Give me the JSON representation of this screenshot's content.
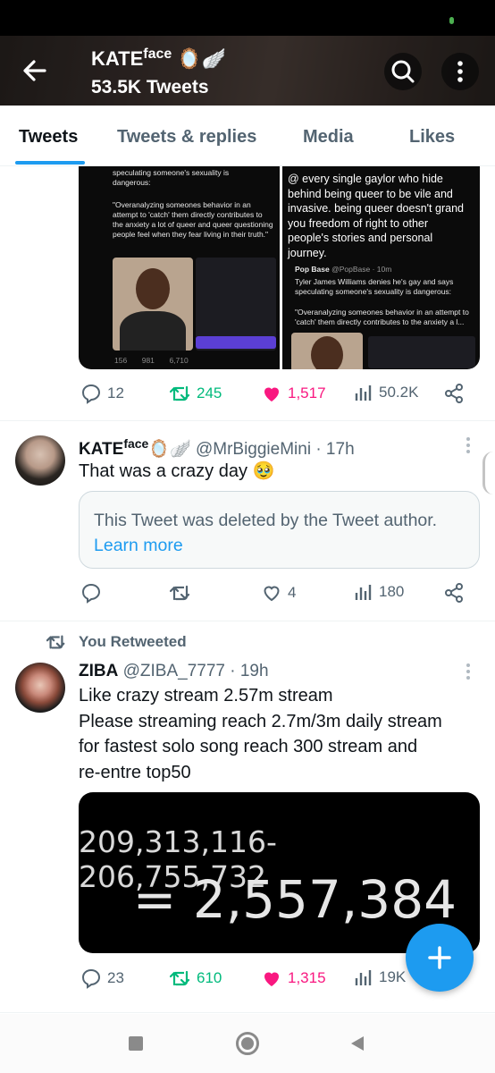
{
  "header": {
    "display_name": "KATE",
    "name_superscript": "face",
    "name_emojis": "🪞🪽",
    "tweet_count": "53.5K Tweets"
  },
  "tabs": [
    {
      "label": "Tweets",
      "active": true
    },
    {
      "label": "Tweets & replies",
      "active": false
    },
    {
      "label": "Media",
      "active": false
    },
    {
      "label": "Likes",
      "active": false
    }
  ],
  "tweet1": {
    "media_left": {
      "quote_head": "speculating someone's sexuality is dangerous:",
      "quote_body": "\"Overanalyzing someones behavior in an attempt to 'catch' them directly contributes to the anxiety a lot of queer and queer questioning people feel when they fear living in their truth.\"",
      "stats": [
        "156",
        "981",
        "6,710"
      ]
    },
    "media_right": {
      "text": "@ every single gaylor who hide behind being queer to be vile and invasive. being queer doesn't grand you freedom of right to other people's stories and personal journey.",
      "quoted_name": "Pop Base",
      "quoted_handle": "@PopBase · 10m",
      "quoted_text": "Tyler James Williams denies he's gay and says speculating someone's sexuality is dangerous:",
      "quoted_quote": "\"Overanalyzing someones behavior in an attempt to 'catch' them directly contributes to the anxiety a l..."
    },
    "replies": "12",
    "retweets": "245",
    "likes": "1,517",
    "views": "50.2K"
  },
  "tweet2": {
    "name": "KATE",
    "name_superscript": "face",
    "name_emojis": "🪞🪽",
    "handle_time": "@MrBiggieMini · 17h",
    "text": "That was a crazy day 🥹",
    "deleted_text": "This Tweet was deleted by the Tweet author.",
    "learn_more": "Learn more",
    "replies": "",
    "retweets": "",
    "likes": "4",
    "views": "180"
  },
  "tweet3": {
    "retweet_label": "You Retweeted",
    "name": "ZIBA",
    "handle_time": "@ZIBA_7777 · 19h",
    "lines": [
      "Like crazy stream 2.57m stream",
      "Please streaming reach 2.7m/3m daily stream",
      "for fastest solo song reach  300 stream and",
      "re-entre top50"
    ],
    "media_line1": "209,313,116-206,755,732",
    "media_line2": "= 2,557,384",
    "replies": "23",
    "retweets": "610",
    "likes": "1,315",
    "views": "19K"
  },
  "colors": {
    "accent": "#1d9bf0",
    "retweet_green": "#00ba7c",
    "like_pink": "#f91880",
    "secondary_text": "#536471"
  },
  "icons": [
    "back-arrow-icon",
    "search-icon",
    "more-vertical-icon",
    "reply-icon",
    "retweet-icon",
    "like-icon",
    "views-icon",
    "share-icon",
    "plus-icon"
  ]
}
